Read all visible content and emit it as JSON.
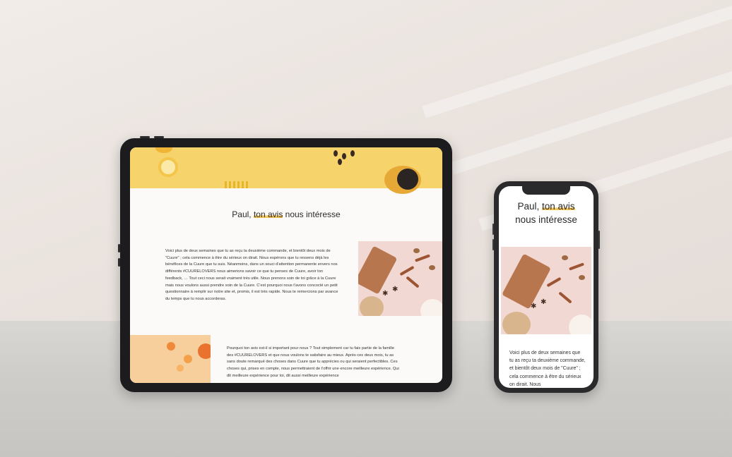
{
  "tablet": {
    "title_name": "Paul, ",
    "title_highlight": "ton avis",
    "title_rest": " nous intéresse",
    "paragraph1": "Voici plus de deux semaines que tu as reçu ta deuxième commande, et bientôt deux mois de \"Cuure\" ; cela commence à être du sérieux on dirait. Nous espérons que tu ressens déjà les bénéfices de la Cuure que tu suis. Néanmoins, dans un souci d'attention permanente envers nos différents #CUURELOVERS nous aimerions savoir ce que tu penses de Cuure, avoir ton feedback, … Tout ceci nous serait vraiment très utile. Nous prenons soin de toi grâce à la Cuure mais nous voulons aussi prendre soin de la Cuure. C'est pourquoi nous t'avons concocté un petit questionnaire à remplir sur notre site et, promis, il est très rapide. Nous te remercions par avance du temps que tu nous accorderas.",
    "paragraph2": "Pourquoi ton avis est-il si important pour nous ? Tout simplement car tu fais partie de la famille des #CUURELOVERS et que nous voulons te satisfaire au mieux. Après ces deux mois, tu as sans doute remarqué des choses dans Cuure que tu apprécies ou qui seraient perfectibles. Ces choses qui, prises en compte, nous permettraient de t'offrir une encore meilleure expérience. Qui dit meilleure expérience pour toi, dit aussi meilleure expérience"
  },
  "phone": {
    "title_name": "Paul, ",
    "title_highlight": "ton avis",
    "title_rest": "nous intéresse",
    "paragraph1": "Voici plus de deux semaines que tu as reçu ta deuxième commande, et bientôt deux mois de \"Cuure\" ; cela commence à être du sérieux on dirait. Nous"
  },
  "colors": {
    "accent_highlight": "#f4c454",
    "hero_yellow": "#f6d36b",
    "device_frame": "#1c1c1e"
  }
}
